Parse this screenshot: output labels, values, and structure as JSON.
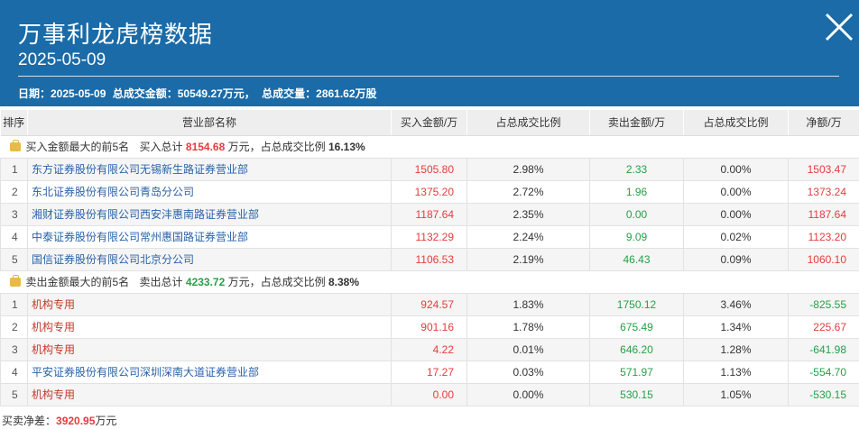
{
  "header": {
    "title": "万事利龙虎榜数据",
    "date": "2025-05-09",
    "summary_date": "日期：2025-05-09",
    "summary_amount": "总成交金额：50549.27万元，",
    "summary_volume": "总成交量：2861.62万股"
  },
  "columns": [
    "排序",
    "营业部名称",
    "买入金额/万",
    "占总成交比例",
    "卖出金额/万",
    "占总成交比例",
    "净额/万"
  ],
  "buy_group": {
    "label": "买入金额最大的前5名",
    "total_label": "买入总计",
    "total": "8154.68",
    "unit_text": "万元，占总成交比例",
    "ratio": "16.13%"
  },
  "buy_rows": [
    {
      "idx": "1",
      "name": "东方证券股份有限公司无锡新生路证券营业部",
      "buy": "1505.80",
      "buy_pct": "2.98%",
      "sell": "2.33",
      "sell_pct": "0.00%",
      "net": "1503.47"
    },
    {
      "idx": "2",
      "name": "东北证券股份有限公司青岛分公司",
      "buy": "1375.20",
      "buy_pct": "2.72%",
      "sell": "1.96",
      "sell_pct": "0.00%",
      "net": "1373.24"
    },
    {
      "idx": "3",
      "name": "湘财证券股份有限公司西安沣惠南路证券营业部",
      "buy": "1187.64",
      "buy_pct": "2.35%",
      "sell": "0.00",
      "sell_pct": "0.00%",
      "net": "1187.64"
    },
    {
      "idx": "4",
      "name": "中泰证券股份有限公司常州惠国路证券营业部",
      "buy": "1132.29",
      "buy_pct": "2.24%",
      "sell": "9.09",
      "sell_pct": "0.02%",
      "net": "1123.20"
    },
    {
      "idx": "5",
      "name": "国信证券股份有限公司北京分公司",
      "buy": "1106.53",
      "buy_pct": "2.19%",
      "sell": "46.43",
      "sell_pct": "0.09%",
      "net": "1060.10"
    }
  ],
  "sell_group": {
    "label": "卖出金额最大的前5名",
    "total_label": "卖出总计",
    "total": "4233.72",
    "unit_text": "万元，占总成交比例",
    "ratio": "8.38%"
  },
  "sell_rows": [
    {
      "idx": "1",
      "name": "机构专用",
      "buy": "924.57",
      "buy_pct": "1.83%",
      "sell": "1750.12",
      "sell_pct": "3.46%",
      "net": "-825.55"
    },
    {
      "idx": "2",
      "name": "机构专用",
      "buy": "901.16",
      "buy_pct": "1.78%",
      "sell": "675.49",
      "sell_pct": "1.34%",
      "net": "225.67"
    },
    {
      "idx": "3",
      "name": "机构专用",
      "buy": "4.22",
      "buy_pct": "0.01%",
      "sell": "646.20",
      "sell_pct": "1.28%",
      "net": "-641.98"
    },
    {
      "idx": "4",
      "name": "平安证券股份有限公司深圳深南大道证券营业部",
      "buy": "17.27",
      "buy_pct": "0.03%",
      "sell": "571.97",
      "sell_pct": "1.13%",
      "net": "-554.70"
    },
    {
      "idx": "5",
      "name": "机构专用",
      "buy": "0.00",
      "buy_pct": "0.00%",
      "sell": "530.15",
      "sell_pct": "1.05%",
      "net": "-530.15"
    }
  ],
  "footer": {
    "label": "买卖净差：",
    "value": "3920.95",
    "unit": "万元"
  },
  "icons": {
    "close": "close-icon",
    "group": "bag-icon"
  },
  "colors": {
    "header_bg": "#1a6ba8",
    "up": "#e43c3c",
    "down": "#26a046",
    "link": "#2a62a8"
  }
}
